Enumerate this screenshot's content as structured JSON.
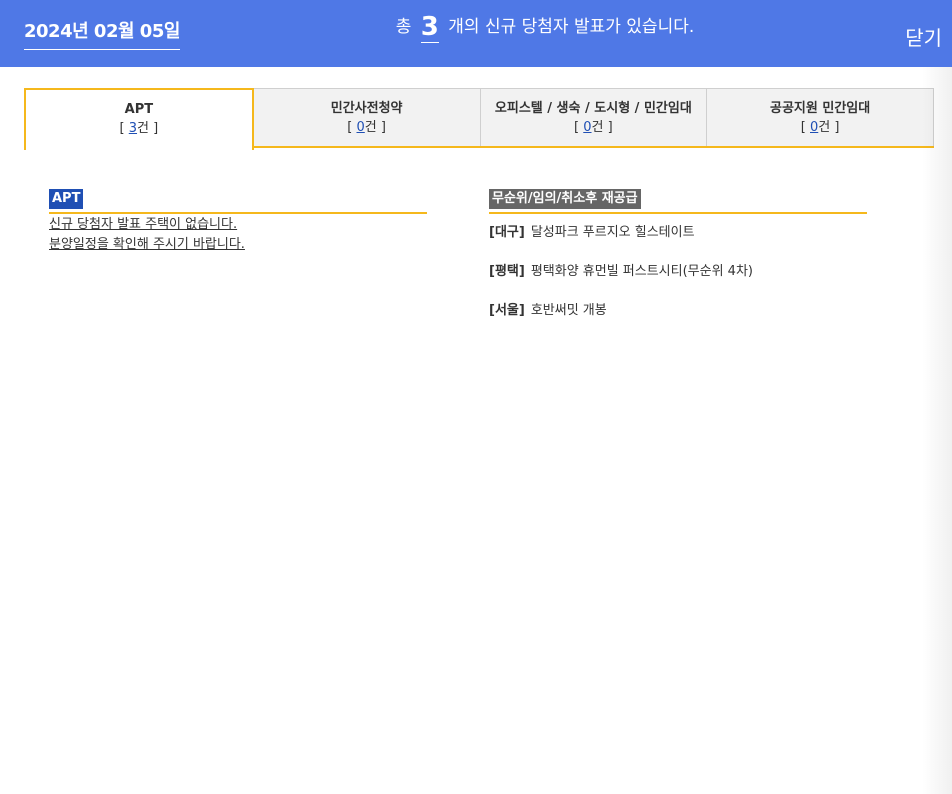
{
  "header": {
    "date": "2024년 02월 05일",
    "summary_prefix": "총",
    "summary_count": "3",
    "summary_suffix": "개의 신규 당첨자 발표가 있습니다.",
    "close_label": "닫기"
  },
  "tabs": [
    {
      "label": "APT",
      "count_open": "[ ",
      "count": "3",
      "count_close": "건 ]"
    },
    {
      "label": "민간사전청약",
      "count_open": "[ ",
      "count": "0",
      "count_close": "건 ]"
    },
    {
      "label": "오피스텔 / 생숙 / 도시형 / 민간임대",
      "count_open": "[ ",
      "count": "0",
      "count_close": "건 ]"
    },
    {
      "label": "공공지원 민간임대",
      "count_open": "[ ",
      "count": "0",
      "count_close": "건 ]"
    }
  ],
  "apt_section": {
    "badge": "APT",
    "message_line1": "신규 당첨자 발표 주택이 없습니다.",
    "message_line2": "분양일정을 확인해 주시기 바랍니다."
  },
  "resupply_section": {
    "badge": "무순위/임의/취소후 재공급",
    "items": [
      {
        "region": "[대구]",
        "name": "달성파크 푸르지오 힐스테이트"
      },
      {
        "region": "[평택]",
        "name": "평택화양 휴먼빌 퍼스트시티(무순위 4차)"
      },
      {
        "region": "[서울]",
        "name": "호반써밋 개봉"
      }
    ]
  },
  "colors": {
    "header_bg": "#4f78e6",
    "accent_yellow": "#f5b81c",
    "badge_blue": "#1f4fb4",
    "badge_gray": "#666666"
  }
}
